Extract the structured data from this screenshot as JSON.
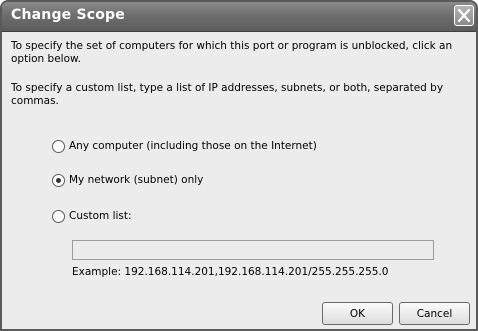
{
  "dialog": {
    "title": "Change Scope",
    "description": "To specify the set of computers for which this port or program is unblocked, click an option below.",
    "custom_instruction": "To specify a custom list, type a list of IP addresses, subnets, or both, separated by commas."
  },
  "options": {
    "any_computer": {
      "label": "Any computer (including those on the Internet)",
      "selected": false
    },
    "my_network": {
      "label": "My network (subnet) only",
      "selected": true
    },
    "custom_list": {
      "label": "Custom list:",
      "selected": false
    }
  },
  "custom_list_input": {
    "value": "",
    "placeholder": ""
  },
  "example_text": "Example: 192.168.114.201,192.168.114.201/255.255.255.0",
  "buttons": {
    "ok": "OK",
    "cancel": "Cancel"
  },
  "icons": {
    "close": "close-icon"
  },
  "colors": {
    "titlebar": "#6e6e6e",
    "dialog_bg": "#ececec"
  }
}
